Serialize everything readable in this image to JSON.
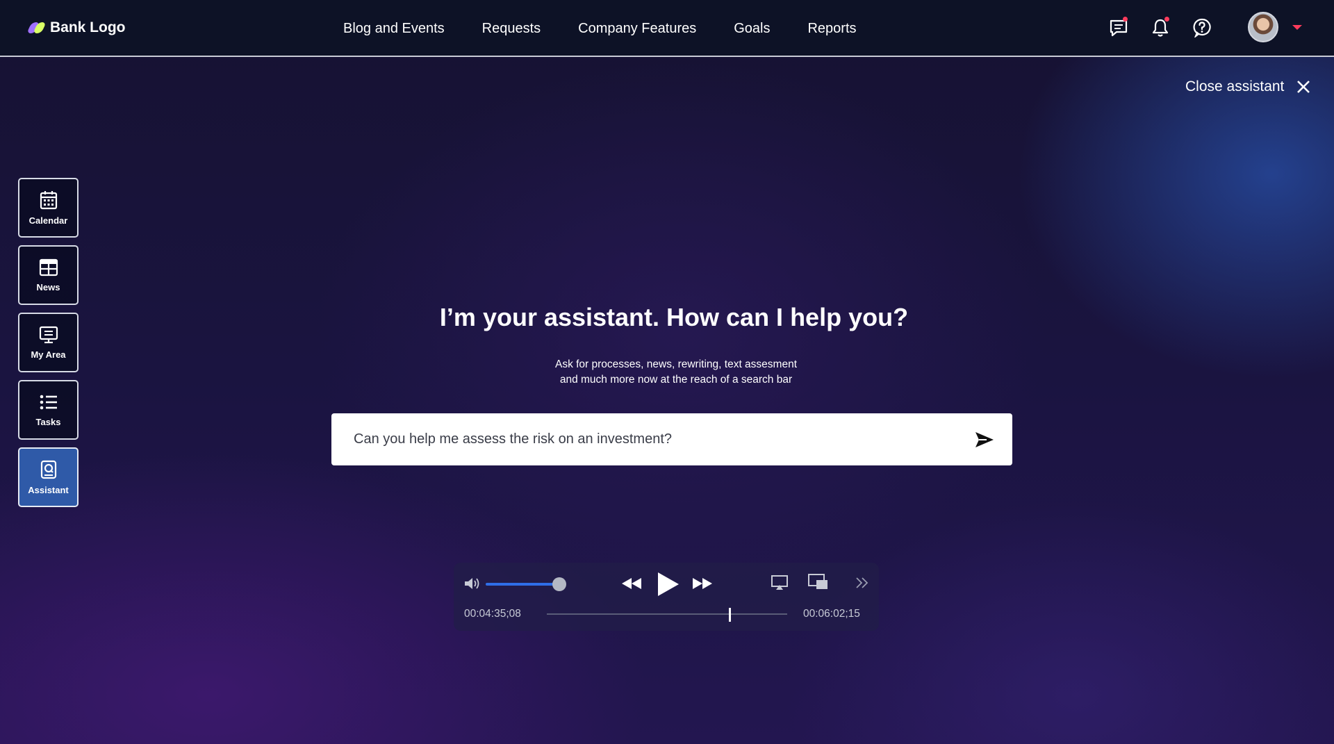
{
  "brand": {
    "logo_text": "Bank Logo"
  },
  "nav": {
    "items": [
      "Blog and Events",
      "Requests",
      "Company Features",
      "Goals",
      "Reports"
    ]
  },
  "header_icons": [
    "chat-icon",
    "bell-icon",
    "help-icon"
  ],
  "close_assistant": {
    "label": "Close assistant"
  },
  "sidebar": {
    "items": [
      {
        "label": "Calendar",
        "icon": "calendar-icon"
      },
      {
        "label": "News",
        "icon": "news-icon"
      },
      {
        "label": "My Area",
        "icon": "my-area-icon"
      },
      {
        "label": "Tasks",
        "icon": "tasks-icon"
      },
      {
        "label": "Assistant",
        "icon": "assistant-icon",
        "active": true
      }
    ]
  },
  "assistant": {
    "headline": "I’m your assistant. How can I help you?",
    "subtext_line1": "Ask for processes, news, rewriting, text assesment",
    "subtext_line2": "and much more now at the reach of a search bar",
    "query": "Can you help me assess the risk on an investment?"
  },
  "player": {
    "current_time": "00:04:35;08",
    "duration": "00:06:02;15",
    "volume_fraction": 0.85,
    "progress_fraction": 0.76
  },
  "colors": {
    "accent": "#2f5aa8",
    "notification": "#ff3b5c",
    "volume": "#2f6ee8"
  }
}
